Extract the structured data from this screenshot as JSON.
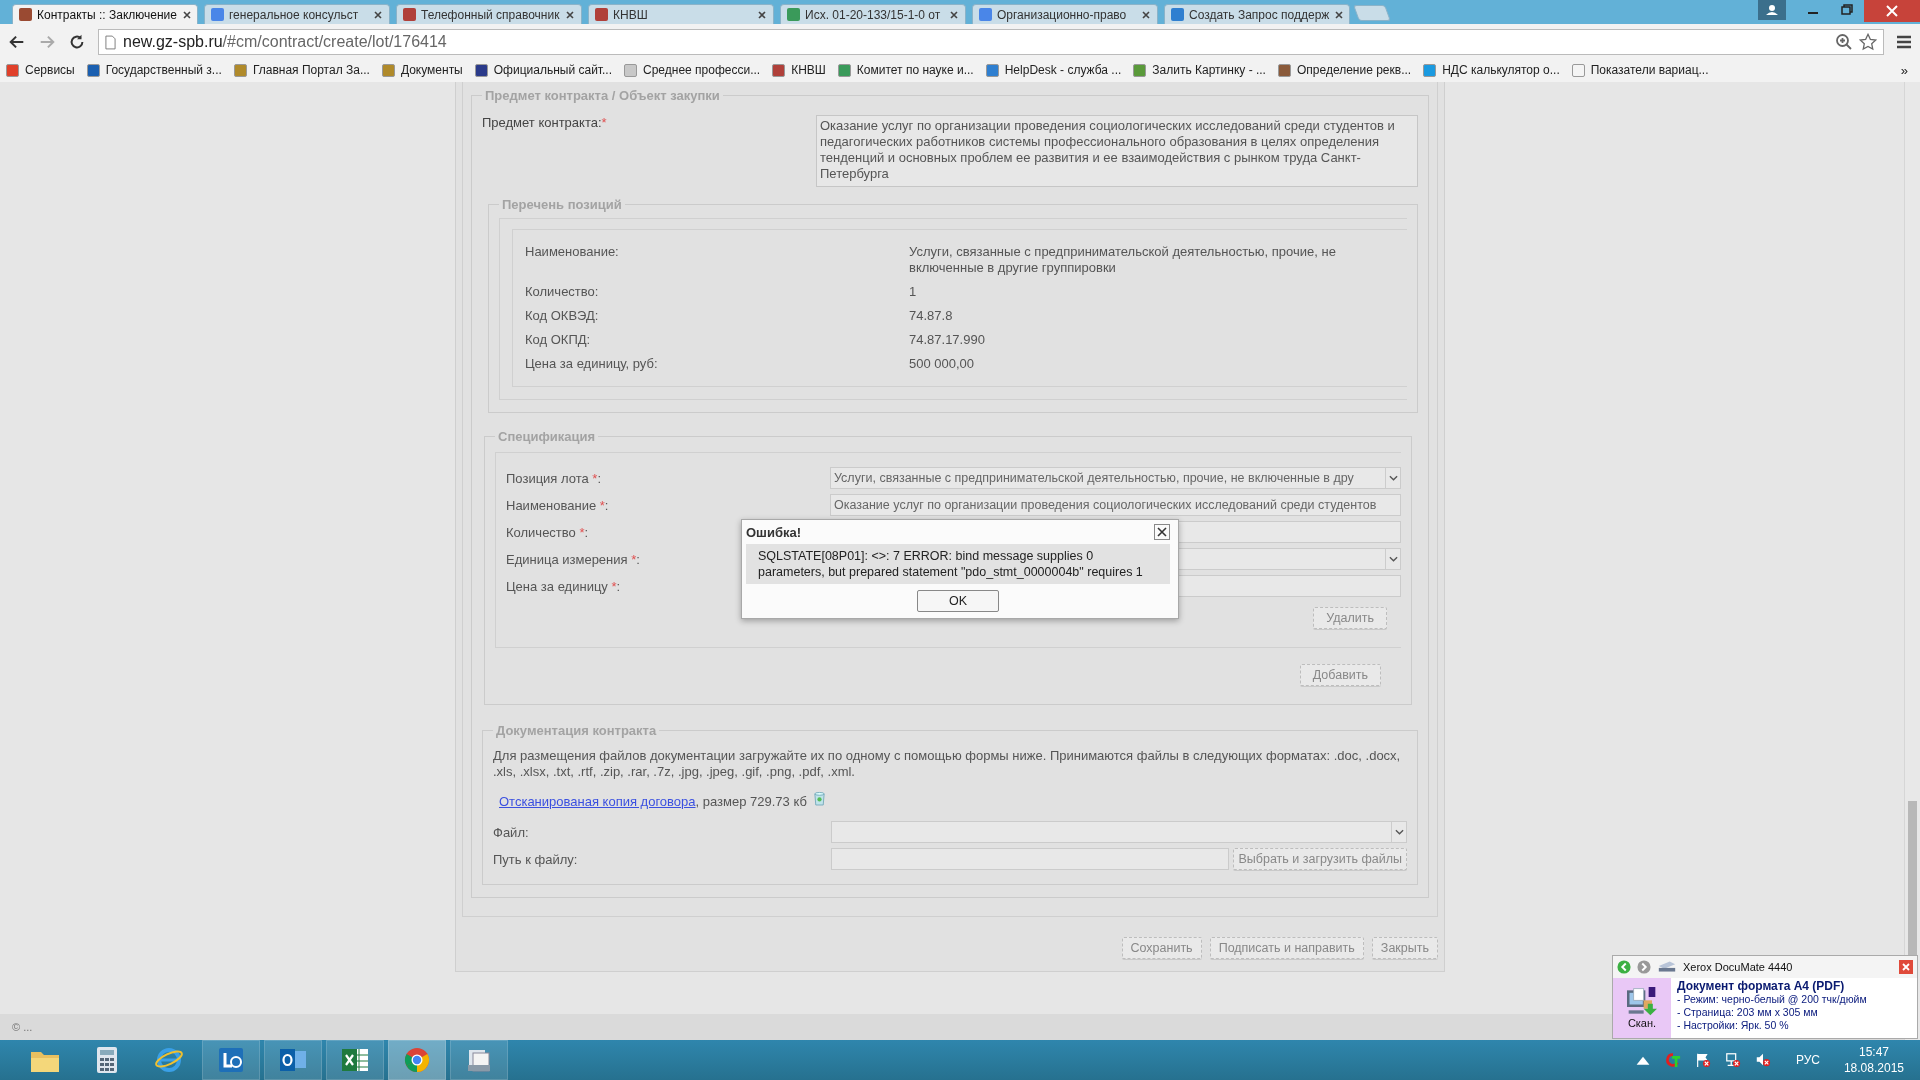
{
  "browser": {
    "tabs": [
      {
        "title": "Контракты :: Заключение",
        "selected": true,
        "color": "#9a4a32"
      },
      {
        "title": "генеральное консульст",
        "selected": false,
        "color": "#4a86e8"
      },
      {
        "title": "Телефонный справочник",
        "selected": false,
        "color": "#b0403a"
      },
      {
        "title": "КНВШ",
        "selected": false,
        "color": "#b0403a"
      },
      {
        "title": "Исх. 01-20-133/15-1-0 от",
        "selected": false,
        "color": "#3a9a5a"
      },
      {
        "title": "Организационно-право",
        "selected": false,
        "color": "#4a86e8"
      },
      {
        "title": "Создать Запрос поддерж",
        "selected": false,
        "color": "#2f7fd0"
      }
    ],
    "address": {
      "host": "new.gz-spb.ru",
      "path": "/#cm/contract/create/lot/176414"
    },
    "bookmarks": [
      {
        "label": "Сервисы",
        "color": "#e0402a"
      },
      {
        "label": "Государственный з...",
        "color": "#1a5fb0"
      },
      {
        "label": "Главная Портал За...",
        "color": "#b08a2a"
      },
      {
        "label": "Документы",
        "color": "#b08a2a"
      },
      {
        "label": "Официальный сайт...",
        "color": "#2a3a8a"
      },
      {
        "label": "Среднее професси...",
        "color": "#c8c8c8"
      },
      {
        "label": "КНВШ",
        "color": "#b0403a"
      },
      {
        "label": "Комитет по науке и...",
        "color": "#3a9a5a"
      },
      {
        "label": "HelpDesk - служба ...",
        "color": "#2f7fd0"
      },
      {
        "label": "Залить Картинку - ...",
        "color": "#5a9a3a"
      },
      {
        "label": "Определение рекв...",
        "color": "#8a5a3a"
      },
      {
        "label": "НДС калькулятор о...",
        "color": "#1a9ae0"
      },
      {
        "label": "Показатели вариац...",
        "color": "#f4f4f4"
      }
    ],
    "more": "»"
  },
  "form": {
    "subject": {
      "legend": "Предмет контракта / Объект закупки",
      "label": "Предмет контракта:",
      "mark": "*",
      "value": "Оказание услуг по организации проведения социологических исследований среди студентов и педагогических работников системы профессионального образования в целях определения тенденций и основных проблем ее развития и ее взаимодействия с рынком труда Санкт-Петербурга"
    },
    "positions": {
      "legend": "Перечень позиций",
      "rows": [
        {
          "label": "Наименование:",
          "value": "Услуги, связанные с предпринимательской деятельностью, прочие, не включенные в другие группировки"
        },
        {
          "label": "Количество:",
          "value": "1"
        },
        {
          "label": "Код ОКВЭД:",
          "value": "74.87.8"
        },
        {
          "label": "Код ОКПД:",
          "value": "74.87.17.990"
        },
        {
          "label": "Цена за единицу, руб:",
          "value": "500 000,00"
        }
      ]
    },
    "spec": {
      "legend": "Спецификация",
      "fields": [
        {
          "label": "Позиция лота ",
          "mark": "*",
          "suffix": ":",
          "kind": "select",
          "value": "Услуги, связанные с предпринимательской деятельностью, прочие, не включенные в дру"
        },
        {
          "label": "Наименование ",
          "mark": "*",
          "suffix": ":",
          "kind": "text",
          "value": "Оказание услуг по организации проведения социологических исследований среди студентов"
        },
        {
          "label": "Количество ",
          "mark": "*",
          "suffix": ":",
          "kind": "text"
        },
        {
          "label": "Единица измерения ",
          "mark": "*",
          "suffix": ":",
          "kind": "select"
        },
        {
          "label": "Цена за единицу ",
          "mark": "*",
          "suffix": ":",
          "kind": "text"
        }
      ],
      "delete_button": "Удалить",
      "add_button": "Добавить"
    },
    "docs": {
      "legend": "Документация контракта",
      "note": "Для размещения файлов документации загружайте их по одному с помощью формы ниже. Принимаются файлы в следующих форматах: .doc, .docx, .xls, .xlsx, .txt, .rtf, .zip, .rar, .7z, .jpg, .jpeg, .gif, .png, .pdf, .xml.",
      "file_link": "Отсканированая копия договора",
      "file_info": ", размер 729.73 кб",
      "fields": [
        {
          "label": "Файл:",
          "kind": "select"
        },
        {
          "label": "Путь к файлу:",
          "kind": "file",
          "button": "Выбрать и загрузить файлы"
        }
      ]
    },
    "actions": [
      "Сохранить",
      "Подписать и направить",
      "Закрыть"
    ]
  },
  "footer": "© ...",
  "dialog": {
    "title": "Ошибка!",
    "message": "SQLSTATE[08P01]: <>: 7 ERROR: bind message supplies 0 parameters, but prepared statement \"pdo_stmt_0000004b\" requires 1",
    "ok": "OK"
  },
  "scanner": {
    "title": "Xerox DocuMate 4440",
    "heading": "Документ формата A4 (PDF)",
    "lines": [
      "- Режим: черно-белый @ 200 тчк/дюйм",
      "- Страница: 203 мм x 305 мм",
      "- Настройки: Ярк. 50 %"
    ],
    "action": "Скан."
  },
  "taskbar": {
    "apps": [
      {
        "kind": "folder",
        "running": false,
        "selected": false
      },
      {
        "kind": "calculator",
        "running": false,
        "selected": false
      },
      {
        "kind": "globe",
        "running": false,
        "selected": false
      },
      {
        "kind": "chat",
        "running": true,
        "selected": false
      },
      {
        "kind": "mail",
        "running": true,
        "selected": false
      },
      {
        "kind": "sheet",
        "running": true,
        "selected": false
      },
      {
        "kind": "wheel",
        "running": true,
        "selected": true
      },
      {
        "kind": "scanner",
        "running": true,
        "selected": false
      }
    ],
    "language": "РУС",
    "time": "15:47",
    "date": "18.08.2015"
  }
}
